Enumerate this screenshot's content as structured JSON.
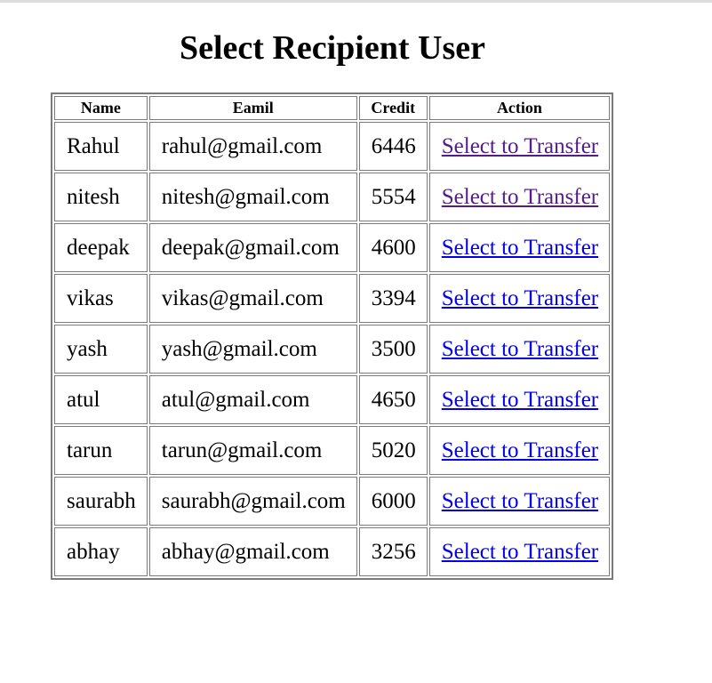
{
  "page": {
    "title": "Select Recipient User"
  },
  "table": {
    "headers": [
      "Name",
      "Eamil",
      "Credit",
      "Action"
    ],
    "rows": [
      {
        "name": "Rahul",
        "email": "rahul@gmail.com",
        "credit": "6446",
        "action": "Select to Transfer",
        "visited": true
      },
      {
        "name": "nitesh",
        "email": "nitesh@gmail.com",
        "credit": "5554",
        "action": "Select to Transfer",
        "visited": true
      },
      {
        "name": "deepak",
        "email": "deepak@gmail.com",
        "credit": "4600",
        "action": "Select to Transfer",
        "visited": false
      },
      {
        "name": "vikas",
        "email": "vikas@gmail.com",
        "credit": "3394",
        "action": "Select to Transfer",
        "visited": false
      },
      {
        "name": "yash",
        "email": "yash@gmail.com",
        "credit": "3500",
        "action": "Select to Transfer",
        "visited": false
      },
      {
        "name": "atul",
        "email": "atul@gmail.com",
        "credit": "4650",
        "action": "Select to Transfer",
        "visited": false
      },
      {
        "name": "tarun",
        "email": "tarun@gmail.com",
        "credit": "5020",
        "action": "Select to Transfer",
        "visited": false
      },
      {
        "name": "saurabh",
        "email": "saurabh@gmail.com",
        "credit": "6000",
        "action": "Select to Transfer",
        "visited": false
      },
      {
        "name": "abhay",
        "email": "abhay@gmail.com",
        "credit": "3256",
        "action": "Select to Transfer",
        "visited": false
      }
    ]
  },
  "colors": {
    "link": "#0000ee",
    "link_visited": "#551a8b",
    "border": "#7a7a7a"
  }
}
